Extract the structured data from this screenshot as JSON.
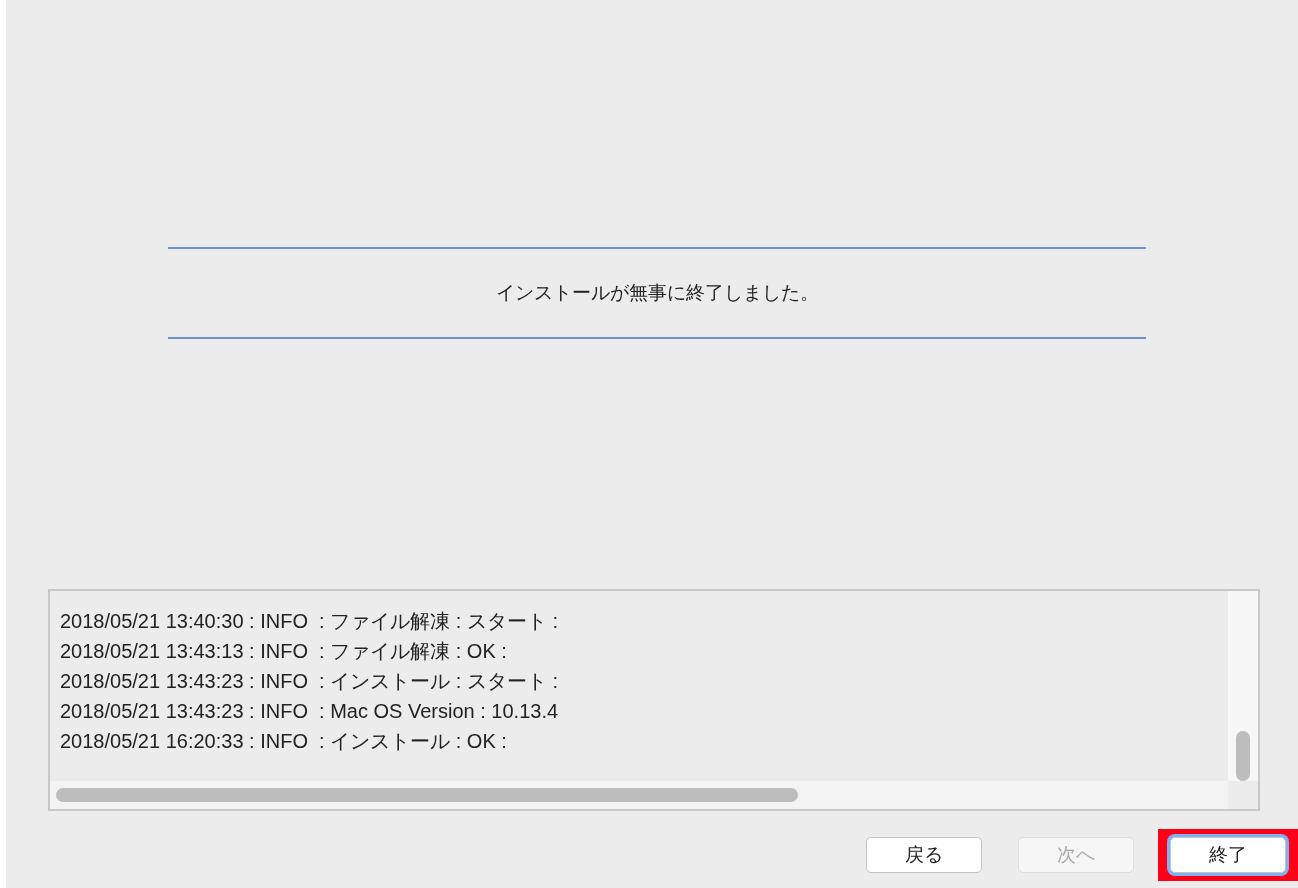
{
  "message": "インストールが無事に終了しました。",
  "log": [
    "2018/05/21 13:40:30 : INFO  : ファイル解凍 : スタート :",
    "2018/05/21 13:43:13 : INFO  : ファイル解凍 : OK :",
    "2018/05/21 13:43:23 : INFO  : インストール : スタート :",
    "2018/05/21 13:43:23 : INFO  : Mac OS Version : 10.13.4",
    "2018/05/21 16:20:33 : INFO  : インストール : OK :"
  ],
  "buttons": [
    {
      "label": "戻る",
      "disabled": false,
      "default": false,
      "highlighted": false
    },
    {
      "label": "次へ",
      "disabled": true,
      "default": false,
      "highlighted": false
    },
    {
      "label": "終了",
      "disabled": false,
      "default": true,
      "highlighted": true
    }
  ]
}
